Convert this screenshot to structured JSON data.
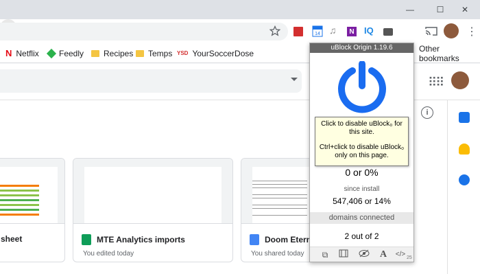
{
  "window": {
    "minimize_glyph": "—",
    "maximize_glyph": "☐",
    "close_glyph": "✕"
  },
  "toolbar": {
    "extensions": [
      {
        "name": "red-book-extension-icon"
      },
      {
        "name": "calendar-extension-icon",
        "badge": "14"
      },
      {
        "name": "music-extension-icon"
      },
      {
        "name": "onenote-extension-icon",
        "label": "N"
      },
      {
        "name": "iq-extension-icon",
        "label": "IQ"
      },
      {
        "name": "video-extension-icon"
      },
      {
        "name": "ublock-extension-icon"
      }
    ]
  },
  "bookmarks": {
    "items": [
      "Netflix",
      "Feedly",
      "Recipes",
      "Temps",
      "YourSoccerDose"
    ],
    "other": "Other bookmarks"
  },
  "docs": {
    "cards": [
      {
        "title": "sheet",
        "subtitle": "",
        "type": "sheet"
      },
      {
        "title": "MTE Analytics imports",
        "subtitle": "You edited today",
        "type": "sheet"
      },
      {
        "title": "Doom Eternal",
        "subtitle": "You shared today",
        "type": "doc"
      }
    ]
  },
  "ublock": {
    "title": "uBlock Origin 1.19.6",
    "tooltip_line1": "Click to disable uBlock₀ for this site.",
    "tooltip_line2": "Ctrl+click to disable uBlock₀ only on this page.",
    "blocked_on_page": "0 or 0%",
    "since_install_label": "since install",
    "since_install_value": "547,406 or 14%",
    "domains_label": "domains connected",
    "domains_value": "2 out of 2",
    "footer_number": "25",
    "power_color": "#1a6cf0"
  }
}
